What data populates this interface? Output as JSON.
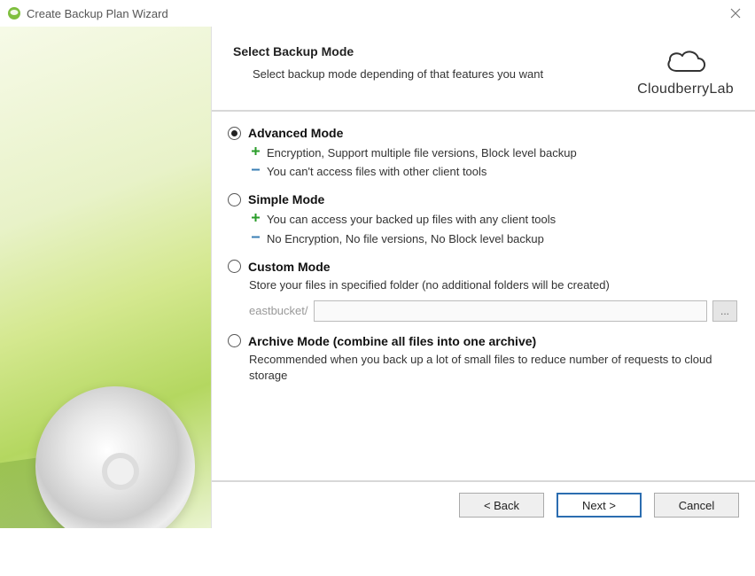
{
  "window": {
    "title": "Create Backup Plan Wizard"
  },
  "brand": {
    "name": "CloudberryLab"
  },
  "header": {
    "title": "Select Backup Mode",
    "subtitle": "Select backup mode depending of that features you want"
  },
  "options": {
    "advanced": {
      "label": "Advanced Mode",
      "selected": true,
      "pros": "Encryption, Support multiple file versions, Block level backup",
      "cons": "You can't access files with other client tools"
    },
    "simple": {
      "label": "Simple Mode",
      "selected": false,
      "pros": "You can access your backed up files with any client tools",
      "cons": "No Encryption, No file versions, No Block level backup"
    },
    "custom": {
      "label": "Custom Mode",
      "selected": false,
      "description": "Store your files in specified folder (no additional folders will be created)",
      "path_prefix": "eastbucket/",
      "path_value": "",
      "browse_label": "..."
    },
    "archive": {
      "label": "Archive Mode (combine all files into one archive)",
      "selected": false,
      "description": "Recommended when you back up a lot of small files to reduce number of requests to cloud storage"
    }
  },
  "footer": {
    "back": "< Back",
    "next": "Next >",
    "cancel": "Cancel"
  }
}
